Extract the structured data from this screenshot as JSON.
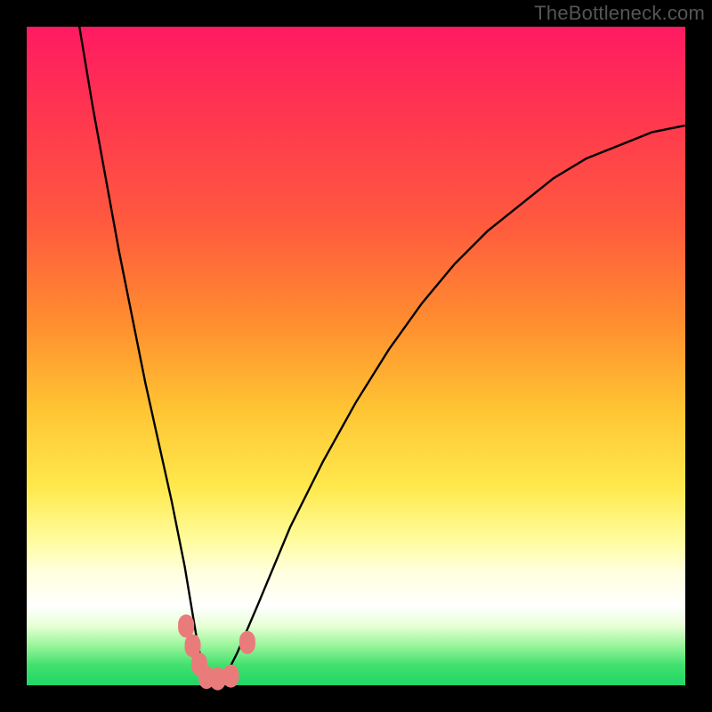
{
  "watermark": "TheBottleneck.com",
  "chart_data": {
    "type": "line",
    "title": "",
    "xlabel": "",
    "ylabel": "",
    "xlim": [
      0,
      100
    ],
    "ylim": [
      0,
      100
    ],
    "series": [
      {
        "name": "bottleneck-curve",
        "x": [
          8,
          10,
          12,
          14,
          16,
          18,
          20,
          22,
          24,
          25,
          26,
          27,
          28,
          29,
          30,
          32,
          35,
          40,
          45,
          50,
          55,
          60,
          65,
          70,
          75,
          80,
          85,
          90,
          95,
          100
        ],
        "y": [
          100,
          88,
          77,
          66,
          56,
          46,
          37,
          28,
          18,
          12,
          6,
          2,
          0,
          0,
          1,
          5,
          12,
          24,
          34,
          43,
          51,
          58,
          64,
          69,
          73,
          77,
          80,
          82,
          84,
          85
        ]
      }
    ],
    "markers": [
      {
        "name": "dot-left-upper",
        "x": 24.2,
        "y": 9.0
      },
      {
        "name": "dot-left-mid",
        "x": 25.2,
        "y": 6.0
      },
      {
        "name": "dot-left-low",
        "x": 26.2,
        "y": 3.2
      },
      {
        "name": "dot-bottom-1",
        "x": 27.3,
        "y": 1.2
      },
      {
        "name": "dot-bottom-2",
        "x": 29.0,
        "y": 1.0
      },
      {
        "name": "dot-bottom-3",
        "x": 31.0,
        "y": 1.4
      },
      {
        "name": "dot-right-upper",
        "x": 33.5,
        "y": 6.5
      }
    ],
    "marker_color": "#e97c7b",
    "curve_color": "#000000"
  }
}
